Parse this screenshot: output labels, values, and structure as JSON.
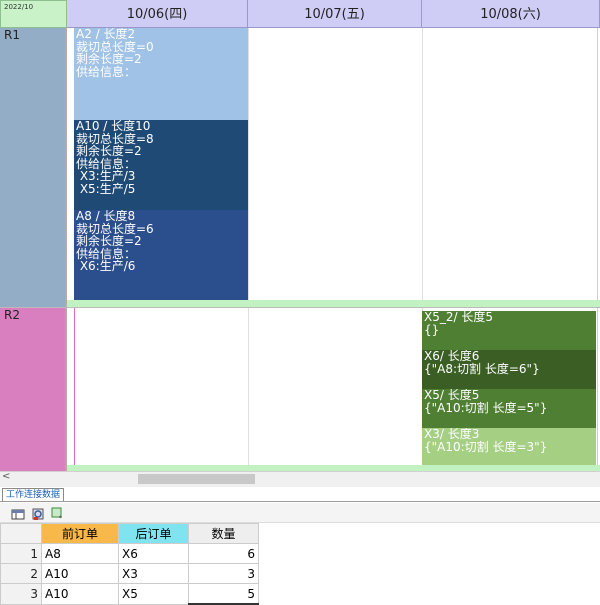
{
  "calendar": {
    "corner_label": "2022/10",
    "days": [
      "10/06(四)",
      "10/07(五)",
      "10/08(六)"
    ],
    "rows": [
      "R1",
      "R2"
    ],
    "jobs_r1": [
      {
        "lines": [
          "A2 / 长度2",
          "裁切总长度=0",
          "剩余长度=2",
          "供给信息："
        ],
        "color": "#9fc2e6"
      },
      {
        "lines": [
          "A10 / 长度10",
          "裁切总长度=8",
          "剩余长度=2",
          "供给信息：",
          " X3:生产/3",
          " X5:生产/5"
        ],
        "color": "#1e4a75"
      },
      {
        "lines": [
          "A8 / 长度8",
          "裁切总长度=6",
          "剩余长度=2",
          "供给信息：",
          " X6:生产/6"
        ],
        "color": "#2b4e8c"
      }
    ],
    "jobs_r2": [
      {
        "lines": [
          "X5_2/ 长度5",
          "{}"
        ],
        "color": "#4f7f32"
      },
      {
        "lines": [
          "X6/ 长度6",
          "{\"A8:切割 长度=6\"}"
        ],
        "color": "#3a5e24"
      },
      {
        "lines": [
          "X5/ 长度5",
          "{\"A10:切割 长度=5\"}"
        ],
        "color": "#4f7f32"
      },
      {
        "lines": [
          "X3/ 长度3",
          "{\"A10:切割 长度=3\"}"
        ],
        "color": "#a5cf83"
      }
    ]
  },
  "scroll_left_arrow": "<",
  "tab": {
    "label": "工作连接数据"
  },
  "table": {
    "headers": [
      "前订单",
      "后订单",
      "数量"
    ],
    "rows": [
      {
        "num": "1",
        "prev": "A8",
        "next": "X6",
        "qty": "6"
      },
      {
        "num": "2",
        "prev": "A10",
        "next": "X3",
        "qty": "3"
      },
      {
        "num": "3",
        "prev": "A10",
        "next": "X5",
        "qty": "5"
      }
    ]
  }
}
